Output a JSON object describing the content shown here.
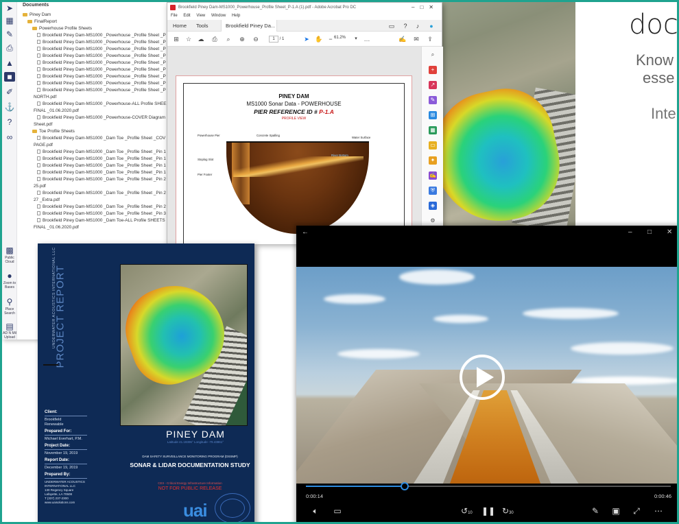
{
  "file_tree": {
    "section_title": "Documents",
    "side_labels": [
      "Public Cloud",
      "Zoom to Bases",
      "Place Search",
      "AD N Mil Upload"
    ],
    "rows": [
      {
        "type": "folder",
        "indent": 0,
        "text": "Piney Dam"
      },
      {
        "type": "folder",
        "indent": 1,
        "text": "FinalReport"
      },
      {
        "type": "folder",
        "indent": 2,
        "text": "Powerhouse Profile Sheets"
      },
      {
        "type": "doc",
        "indent": 3,
        "text": "Brookfield Piney Dam-MS1000 _Powerhouse _Profile Sheet _P"
      },
      {
        "type": "doc",
        "indent": 3,
        "text": "Brookfield Piney Dam-MS1000 _Powerhouse _Profile Sheet _P"
      },
      {
        "type": "doc",
        "indent": 3,
        "text": "Brookfield Piney Dam-MS1000 _Powerhouse _Profile Sheet _P"
      },
      {
        "type": "doc",
        "indent": 3,
        "text": "Brookfield Piney Dam-MS1000 _Powerhouse _Profile Sheet _P"
      },
      {
        "type": "doc",
        "indent": 3,
        "text": "Brookfield Piney Dam-MS1000 _Powerhouse _Profile Sheet _P"
      },
      {
        "type": "doc",
        "indent": 3,
        "text": "Brookfield Piney Dam-MS1000 _Powerhouse _Profile Sheet _P"
      },
      {
        "type": "doc",
        "indent": 3,
        "text": "Brookfield Piney Dam-MS1000 _Powerhouse _Profile Sheet _P"
      },
      {
        "type": "doc",
        "indent": 3,
        "text": "Brookfield Piney Dam-MS1000 _Powerhouse _Profile Sheet _P"
      },
      {
        "type": "doc",
        "indent": 3,
        "text": "Brookfield Piney Dam-MS1000 _Powerhouse _Profile Sheet _P"
      },
      {
        "type": "cont",
        "indent": 0,
        "text": "NORTH.pdf"
      },
      {
        "type": "doc",
        "indent": 3,
        "text": "Brookfield Piney Dam-MS1000 _Powerhouse-ALL Profile SHEE"
      },
      {
        "type": "cont",
        "indent": 0,
        "text": "FINAL _01.06.2020.pdf"
      },
      {
        "type": "doc",
        "indent": 3,
        "text": "Brookfield Piney Dam-MS1000 _Powerhouse-COVER Diagram"
      },
      {
        "type": "cont",
        "indent": 0,
        "text": "Sheet.pdf"
      },
      {
        "type": "folder",
        "indent": 2,
        "text": "Toe Profile Sheets"
      },
      {
        "type": "doc",
        "indent": 3,
        "text": "Brookfield Piney Dam-MS1000 _Dam Toe _Profile Sheet _COV"
      },
      {
        "type": "cont",
        "indent": 0,
        "text": "PAGE.pdf"
      },
      {
        "type": "doc",
        "indent": 3,
        "text": "Brookfield Piney Dam-MS1000 _Dam Toe _Profile Sheet _Pin 1"
      },
      {
        "type": "doc",
        "indent": 3,
        "text": "Brookfield Piney Dam-MS1000 _Dam Toe _Profile Sheet _Pin 1"
      },
      {
        "type": "doc",
        "indent": 3,
        "text": "Brookfield Piney Dam-MS1000 _Dam Toe _Profile Sheet _Pin 1"
      },
      {
        "type": "doc",
        "indent": 3,
        "text": "Brookfield Piney Dam-MS1000 _Dam Toe _Profile Sheet _Pin 1"
      },
      {
        "type": "doc",
        "indent": 3,
        "text": "Brookfield Piney Dam-MS1000 _Dam Toe _Profile Sheet _Pin 2"
      },
      {
        "type": "cont",
        "indent": 0,
        "text": "25.pdf"
      },
      {
        "type": "doc",
        "indent": 3,
        "text": "Brookfield Piney Dam-MS1000 _Dam Toe _Profile Sheet _Pin 2"
      },
      {
        "type": "cont",
        "indent": 0,
        "text": "27 _Extra.pdf"
      },
      {
        "type": "doc",
        "indent": 3,
        "text": "Brookfield Piney Dam-MS1000 _Dam Toe _Profile Sheet _Pin 2"
      },
      {
        "type": "doc",
        "indent": 3,
        "text": "Brookfield Piney Dam-MS1000 _Dam Toe _Profile Sheet _Pin 3"
      },
      {
        "type": "doc",
        "indent": 3,
        "text": "Brookfield Piney Dam-MS1000 _Dam Toe-ALL Profile SHEETS"
      },
      {
        "type": "cont",
        "indent": 0,
        "text": "FINAL _01.06.2020.pdf"
      }
    ]
  },
  "acrobat": {
    "title": "Brookfield Piney Dam-MS1000_Powerhouse_Profile Sheet_P-1.A (1).pdf - Adobe Acrobat Pro DC",
    "menu": [
      "File",
      "Edit",
      "View",
      "Window",
      "Help"
    ],
    "tabs": {
      "home": "Home",
      "tools": "Tools",
      "doc": "Brookfield Piney Da..."
    },
    "page_current": "1",
    "page_total": "/ 1",
    "zoom": "61.2%",
    "pdf": {
      "line1": "PINEY DAM",
      "line2": "MS1000 Sonar Data - POWERHOUSE",
      "line3_prefix": "PIER REFERENCE ID #",
      "line3_id": "P-1.A",
      "line4": "PROFILE VIEW",
      "labels": {
        "powerhouse_pier": "Powerhouse Pier",
        "concrete_spalling": "Concrete Spalling",
        "water_surface": "Water Surface",
        "river_bottom": "River Bottom",
        "stoplog_slot": "Stoplog Slot",
        "pier_footer": "Pier Footer"
      }
    }
  },
  "slide": {
    "title": "doc",
    "sub1_line1": "Know",
    "sub1_line2": "esse",
    "sub2": "Inte"
  },
  "report": {
    "vertical_company": "UNDERWATER ACOUSTICS INTERNATIONAL LLC",
    "vertical_title": "PROJECT REPORT",
    "client_label": "Client:",
    "client_value1": "Brookfield",
    "client_value2": "Renewable",
    "prepared_for_label": "Prepared For:",
    "prepared_for_value": "Michael Everhart, P.M.",
    "project_date_label": "Project Date:",
    "project_date_value": "November 19, 2019",
    "report_date_label": "Report Date:",
    "report_date_value": "December 19, 2019",
    "prepared_by_label": "Prepared By:",
    "prepared_by_lines": [
      "UNDERWATER ACOUSTICS",
      "INTERNATIONAL LLC",
      "130 Regency Square",
      "Lafayette, LA 70508",
      "T (337) 237-2300",
      "www.uaisolutions.com"
    ],
    "title": "PINEY DAM",
    "coords": "Latitude 41.19306°   Longitude -79.43861°",
    "program": "DAM SAFETY SURVEILLANCE MONITORING PROGRAM (DSSMP)",
    "study": "SONAR & LIDAR DOCUMENTATION STUDY",
    "cei": "CEII - Critical Energy Infrastructure Information",
    "not_public": "NOT FOR PUBLIC RELEASE",
    "logo": "uai"
  },
  "player": {
    "time_current": "0:00:14",
    "time_total": "0:00:46",
    "progress_fraction": 0.27,
    "skip_back": "10",
    "skip_forward": "30"
  }
}
